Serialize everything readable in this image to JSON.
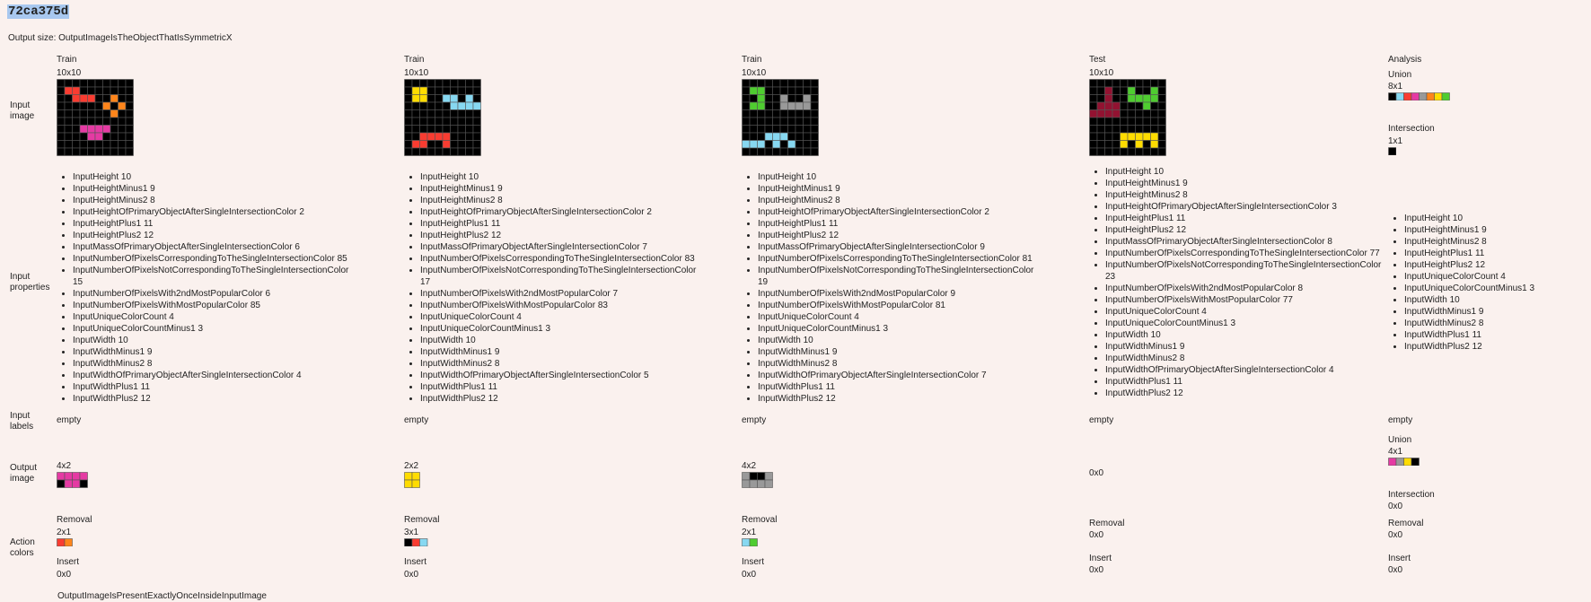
{
  "task_id": "72ca375d",
  "output_size_label": "Output size: OutputImageIsTheObjectThatIsSymmetricX",
  "row_labels": {
    "input_image": [
      "Input",
      "image"
    ],
    "input_properties": [
      "Input",
      "properties"
    ],
    "input_labels": [
      "Input",
      "labels"
    ],
    "output_image": [
      "Output",
      "image"
    ],
    "action_colors": [
      "Action",
      "colors"
    ]
  },
  "palette": {
    "0": "#000000",
    "1": "#1e93ff",
    "2": "#f93c31",
    "3": "#4fcc30",
    "4": "#ffdc00",
    "5": "#999999",
    "6": "#e53aa3",
    "7": "#ff851b",
    "8": "#87d8f1",
    "9": "#921231"
  },
  "columns": [
    {
      "header": "Train",
      "input_size": "10x10",
      "input_grid": [
        [
          0,
          0,
          0,
          0,
          0,
          0,
          0,
          0,
          0,
          0
        ],
        [
          0,
          2,
          2,
          0,
          0,
          0,
          0,
          0,
          0,
          0
        ],
        [
          0,
          0,
          2,
          2,
          2,
          0,
          0,
          7,
          0,
          0
        ],
        [
          0,
          0,
          0,
          0,
          0,
          0,
          7,
          0,
          7,
          0
        ],
        [
          0,
          0,
          0,
          0,
          0,
          0,
          0,
          7,
          0,
          0
        ],
        [
          0,
          0,
          0,
          0,
          0,
          0,
          0,
          0,
          0,
          0
        ],
        [
          0,
          0,
          0,
          6,
          6,
          6,
          6,
          0,
          0,
          0
        ],
        [
          0,
          0,
          0,
          0,
          6,
          6,
          0,
          0,
          0,
          0
        ],
        [
          0,
          0,
          0,
          0,
          0,
          0,
          0,
          0,
          0,
          0
        ],
        [
          0,
          0,
          0,
          0,
          0,
          0,
          0,
          0,
          0,
          0
        ]
      ],
      "properties": [
        "InputHeight 10",
        "InputHeightMinus1 9",
        "InputHeightMinus2 8",
        "InputHeightOfPrimaryObjectAfterSingleIntersectionColor 2",
        "InputHeightPlus1 11",
        "InputHeightPlus2 12",
        "InputMassOfPrimaryObjectAfterSingleIntersectionColor 6",
        "InputNumberOfPixelsCorrespondingToTheSingleIntersectionColor 85",
        "InputNumberOfPixelsNotCorrespondingToTheSingleIntersectionColor 15",
        "InputNumberOfPixelsWith2ndMostPopularColor 6",
        "InputNumberOfPixelsWithMostPopularColor 85",
        "InputUniqueColorCount 4",
        "InputUniqueColorCountMinus1 3",
        "InputWidth 10",
        "InputWidthMinus1 9",
        "InputWidthMinus2 8",
        "InputWidthOfPrimaryObjectAfterSingleIntersectionColor 4",
        "InputWidthPlus1 11",
        "InputWidthPlus2 12"
      ],
      "input_labels": "empty",
      "output_size": "4x2",
      "output_grid": [
        [
          6,
          6,
          6,
          6
        ],
        [
          0,
          6,
          6,
          0
        ]
      ],
      "removal_label": "Removal",
      "removal_size": "2x1",
      "removal_colors": [
        2,
        7
      ],
      "insert_label": "Insert",
      "insert_size": "0x0"
    },
    {
      "header": "Train",
      "input_size": "10x10",
      "input_grid": [
        [
          0,
          0,
          0,
          0,
          0,
          0,
          0,
          0,
          0,
          0
        ],
        [
          0,
          4,
          4,
          0,
          0,
          0,
          0,
          0,
          0,
          0
        ],
        [
          0,
          4,
          4,
          0,
          0,
          8,
          8,
          0,
          8,
          0
        ],
        [
          0,
          0,
          0,
          0,
          0,
          0,
          8,
          8,
          8,
          8
        ],
        [
          0,
          0,
          0,
          0,
          0,
          0,
          0,
          0,
          0,
          0
        ],
        [
          0,
          0,
          0,
          0,
          0,
          0,
          0,
          0,
          0,
          0
        ],
        [
          0,
          0,
          0,
          0,
          0,
          0,
          0,
          0,
          0,
          0
        ],
        [
          0,
          0,
          2,
          2,
          2,
          2,
          0,
          0,
          0,
          0
        ],
        [
          0,
          2,
          2,
          0,
          0,
          2,
          0,
          0,
          0,
          0
        ],
        [
          0,
          0,
          0,
          0,
          0,
          0,
          0,
          0,
          0,
          0
        ]
      ],
      "properties": [
        "InputHeight 10",
        "InputHeightMinus1 9",
        "InputHeightMinus2 8",
        "InputHeightOfPrimaryObjectAfterSingleIntersectionColor 2",
        "InputHeightPlus1 11",
        "InputHeightPlus2 12",
        "InputMassOfPrimaryObjectAfterSingleIntersectionColor 7",
        "InputNumberOfPixelsCorrespondingToTheSingleIntersectionColor 83",
        "InputNumberOfPixelsNotCorrespondingToTheSingleIntersectionColor 17",
        "InputNumberOfPixelsWith2ndMostPopularColor 7",
        "InputNumberOfPixelsWithMostPopularColor 83",
        "InputUniqueColorCount 4",
        "InputUniqueColorCountMinus1 3",
        "InputWidth 10",
        "InputWidthMinus1 9",
        "InputWidthMinus2 8",
        "InputWidthOfPrimaryObjectAfterSingleIntersectionColor 5",
        "InputWidthPlus1 11",
        "InputWidthPlus2 12"
      ],
      "input_labels": "empty",
      "output_size": "2x2",
      "output_grid": [
        [
          4,
          4
        ],
        [
          4,
          4
        ]
      ],
      "removal_label": "Removal",
      "removal_size": "3x1",
      "removal_colors": [
        0,
        2,
        8
      ],
      "insert_label": "Insert",
      "insert_size": "0x0"
    },
    {
      "header": "Train",
      "input_size": "10x10",
      "input_grid": [
        [
          0,
          0,
          0,
          0,
          0,
          0,
          0,
          0,
          0,
          0
        ],
        [
          0,
          3,
          3,
          0,
          0,
          0,
          0,
          0,
          0,
          0
        ],
        [
          0,
          0,
          3,
          0,
          0,
          5,
          0,
          0,
          5,
          0
        ],
        [
          0,
          3,
          3,
          0,
          0,
          5,
          5,
          5,
          5,
          0
        ],
        [
          0,
          0,
          0,
          0,
          0,
          0,
          0,
          0,
          0,
          0
        ],
        [
          0,
          0,
          0,
          0,
          0,
          0,
          0,
          0,
          0,
          0
        ],
        [
          0,
          0,
          0,
          0,
          0,
          0,
          0,
          0,
          0,
          0
        ],
        [
          0,
          0,
          0,
          8,
          8,
          8,
          0,
          0,
          0,
          0
        ],
        [
          8,
          8,
          8,
          0,
          8,
          0,
          8,
          0,
          0,
          0
        ],
        [
          0,
          0,
          0,
          0,
          0,
          0,
          0,
          0,
          0,
          0
        ]
      ],
      "properties": [
        "InputHeight 10",
        "InputHeightMinus1 9",
        "InputHeightMinus2 8",
        "InputHeightOfPrimaryObjectAfterSingleIntersectionColor 2",
        "InputHeightPlus1 11",
        "InputHeightPlus2 12",
        "InputMassOfPrimaryObjectAfterSingleIntersectionColor 9",
        "InputNumberOfPixelsCorrespondingToTheSingleIntersectionColor 81",
        "InputNumberOfPixelsNotCorrespondingToTheSingleIntersectionColor 19",
        "InputNumberOfPixelsWith2ndMostPopularColor 9",
        "InputNumberOfPixelsWithMostPopularColor 81",
        "InputUniqueColorCount 4",
        "InputUniqueColorCountMinus1 3",
        "InputWidth 10",
        "InputWidthMinus1 9",
        "InputWidthMinus2 8",
        "InputWidthOfPrimaryObjectAfterSingleIntersectionColor 7",
        "InputWidthPlus1 11",
        "InputWidthPlus2 12"
      ],
      "input_labels": "empty",
      "output_size": "4x2",
      "output_grid": [
        [
          5,
          0,
          0,
          5
        ],
        [
          5,
          5,
          5,
          5
        ]
      ],
      "removal_label": "Removal",
      "removal_size": "2x1",
      "removal_colors": [
        8,
        3
      ],
      "insert_label": "Insert",
      "insert_size": "0x0"
    },
    {
      "header": "Test",
      "input_size": "10x10",
      "input_grid": [
        [
          0,
          0,
          0,
          0,
          0,
          0,
          0,
          0,
          0,
          0
        ],
        [
          0,
          0,
          9,
          0,
          0,
          3,
          0,
          0,
          3,
          0
        ],
        [
          0,
          0,
          9,
          0,
          0,
          3,
          3,
          3,
          3,
          0
        ],
        [
          0,
          9,
          9,
          9,
          0,
          0,
          0,
          3,
          0,
          0
        ],
        [
          9,
          9,
          9,
          9,
          0,
          0,
          0,
          0,
          0,
          0
        ],
        [
          0,
          0,
          0,
          0,
          0,
          0,
          0,
          0,
          0,
          0
        ],
        [
          0,
          0,
          0,
          0,
          0,
          0,
          0,
          0,
          0,
          0
        ],
        [
          0,
          0,
          0,
          0,
          4,
          4,
          4,
          4,
          4,
          0
        ],
        [
          0,
          0,
          0,
          0,
          4,
          0,
          4,
          0,
          4,
          0
        ],
        [
          0,
          0,
          0,
          0,
          0,
          0,
          0,
          0,
          0,
          0
        ]
      ],
      "properties": [
        "InputHeight 10",
        "InputHeightMinus1 9",
        "InputHeightMinus2 8",
        "InputHeightOfPrimaryObjectAfterSingleIntersectionColor 3",
        "InputHeightPlus1 11",
        "InputHeightPlus2 12",
        "InputMassOfPrimaryObjectAfterSingleIntersectionColor 8",
        "InputNumberOfPixelsCorrespondingToTheSingleIntersectionColor 77",
        "InputNumberOfPixelsNotCorrespondingToTheSingleIntersectionColor 23",
        "InputNumberOfPixelsWith2ndMostPopularColor 8",
        "InputNumberOfPixelsWithMostPopularColor 77",
        "InputUniqueColorCount 4",
        "InputUniqueColorCountMinus1 3",
        "InputWidth 10",
        "InputWidthMinus1 9",
        "InputWidthMinus2 8",
        "InputWidthOfPrimaryObjectAfterSingleIntersectionColor 4",
        "InputWidthPlus1 11",
        "InputWidthPlus2 12"
      ],
      "input_labels": "empty",
      "output_size": "0x0",
      "removal_label": "Removal",
      "removal_size": "0x0",
      "insert_label": "Insert",
      "insert_size": "0x0"
    }
  ],
  "analysis": {
    "header": "Analysis",
    "union_label": "Union",
    "union_size": "8x1",
    "union_colors": [
      0,
      8,
      2,
      6,
      5,
      7,
      4,
      3
    ],
    "intersection_label": "Intersection",
    "intersection_size": "1x1",
    "intersection_colors": [
      0
    ],
    "properties": [
      "InputHeight 10",
      "InputHeightMinus1 9",
      "InputHeightMinus2 8",
      "InputHeightPlus1 11",
      "InputHeightPlus2 12",
      "InputUniqueColorCount 4",
      "InputUniqueColorCountMinus1 3",
      "InputWidth 10",
      "InputWidthMinus1 9",
      "InputWidthMinus2 8",
      "InputWidthPlus1 11",
      "InputWidthPlus2 12"
    ],
    "input_labels": "empty",
    "output_union_label": "Union",
    "output_union_size": "4x1",
    "output_union_colors": [
      6,
      5,
      4,
      0
    ],
    "output_intersection_label": "Intersection",
    "output_intersection_size": "0x0",
    "removal_label": "Removal",
    "removal_size": "0x0",
    "insert_label": "Insert",
    "insert_size": "0x0"
  },
  "bottom_note": "OutputImageIsPresentExactlyOnceInsideInputImage"
}
